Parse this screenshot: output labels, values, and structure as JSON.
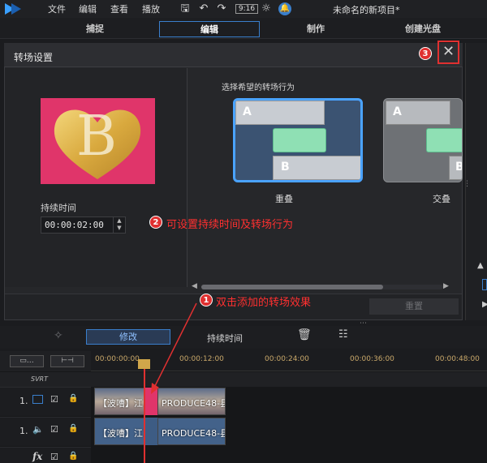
{
  "menubar": {
    "items": [
      "文件",
      "编辑",
      "查看",
      "播放"
    ],
    "project_title": "未命名的新项目*"
  },
  "tabs": [
    "捕捉",
    "编辑",
    "制作",
    "创建光盘"
  ],
  "dialog": {
    "title": "转场设置",
    "close_label": "✕",
    "duration_label": "持续时间",
    "duration_value": "00:00:02:00",
    "behavior_prompt": "选择希望的转场行为",
    "behaviors": [
      {
        "label": "重叠",
        "a": "A",
        "b": "B"
      },
      {
        "label": "交叠",
        "a": "A",
        "b": "B"
      }
    ],
    "reset_label": "重置",
    "preview_letter": "B"
  },
  "toolbar": {
    "modify_label": "修改",
    "duration_label": "持续时间"
  },
  "timeline": {
    "ticks": [
      "00:00:00:00",
      "00:00:12:00",
      "00:00:24:00",
      "00:00:36:00",
      "00:00:48:00"
    ],
    "svrt": "SVRT",
    "tracks": [
      {
        "num": "1.",
        "clips": [
          "【波嘈】江",
          "PRODUCE48-县"
        ]
      },
      {
        "num": "1.",
        "clips": [
          "【波嘈】江",
          "PRODUCE48-县"
        ]
      }
    ],
    "fx_label": "fx"
  },
  "annotations": {
    "note1_badge": "1",
    "note1_text": "双击添加的转场效果",
    "note2_badge": "2",
    "note2_text": "可设置持续时间及转场行为",
    "note3_badge": "3"
  },
  "colors": {
    "accent": "#3a7fcc",
    "annotation_red": "#e03030",
    "preview_bg": "#e0356a"
  }
}
